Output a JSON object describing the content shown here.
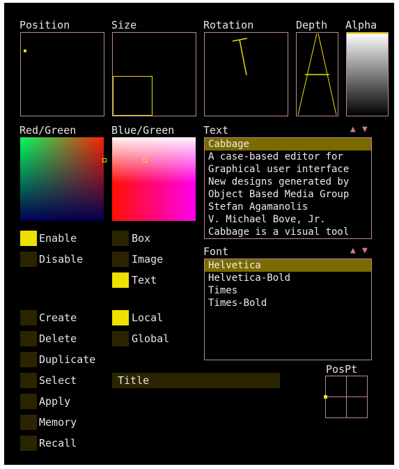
{
  "colors": {
    "accent": "#eee000",
    "swatch_off": "#2a2400",
    "border": "#b98a98",
    "selection": "#7a6a00",
    "scroll_arrow": "#d07a8a"
  },
  "panels": {
    "position": "Position",
    "size": "Size",
    "rotation": "Rotation",
    "depth": "Depth",
    "alpha": "Alpha",
    "red_green": "Red/Green",
    "blue_green": "Blue/Green",
    "pospt": "PosPt"
  },
  "text_list": {
    "label": "Text",
    "items": [
      "Cabbage",
      "A case-based editor for",
      "Graphical user interface",
      "New designs generated by",
      "Object Based Media Group",
      "Stefan Agamanolis",
      "V. Michael Bove, Jr.",
      "Cabbage is a visual tool"
    ],
    "selected_index": 0
  },
  "font_list": {
    "label": "Font",
    "items": [
      "Helvetica",
      "Helvetica-Bold",
      "Times",
      "Times-Bold"
    ],
    "selected_index": 0
  },
  "toggles": {
    "enable": {
      "label": "Enable",
      "on": true
    },
    "disable": {
      "label": "Disable",
      "on": false
    },
    "box": {
      "label": "Box",
      "on": false
    },
    "image": {
      "label": "Image",
      "on": false
    },
    "text": {
      "label": "Text",
      "on": true
    },
    "local": {
      "label": "Local",
      "on": true
    },
    "global": {
      "label": "Global",
      "on": false
    }
  },
  "actions": {
    "create": "Create",
    "delete": "Delete",
    "duplicate": "Duplicate",
    "select": "Select",
    "apply": "Apply",
    "memory": "Memory",
    "recall": "Recall"
  },
  "title_field": {
    "value": "Title"
  },
  "icons": {
    "scroll_up": "▲",
    "scroll_down": "▼"
  }
}
